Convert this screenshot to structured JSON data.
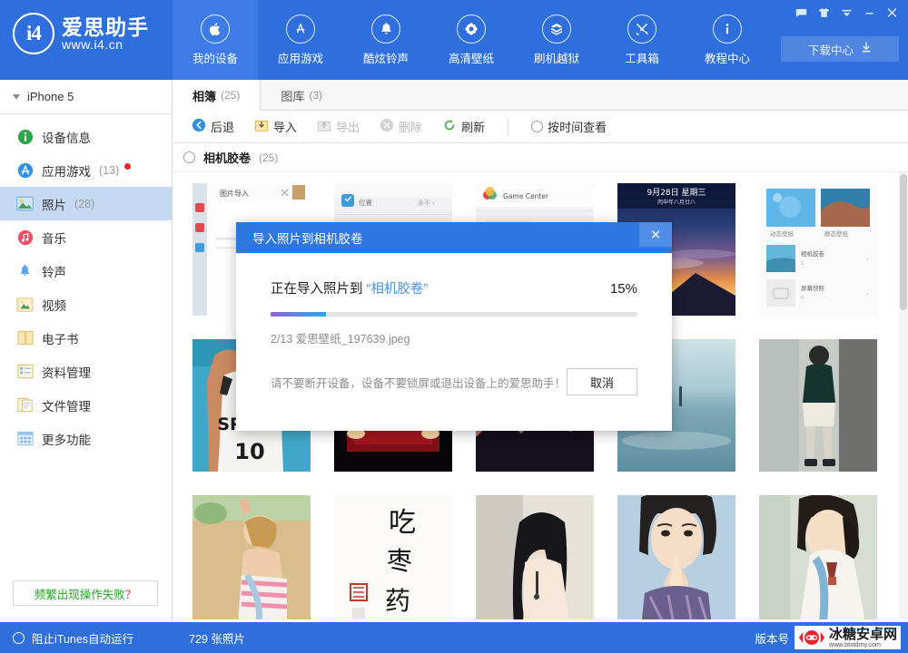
{
  "header": {
    "brand": {
      "logo_text": "i4",
      "name": "爱思助手",
      "url": "www.i4.cn"
    },
    "nav": [
      {
        "label": "我的设备",
        "icon": "apple-icon",
        "active": true
      },
      {
        "label": "应用游戏",
        "icon": "appstore-icon",
        "active": false
      },
      {
        "label": "酷炫铃声",
        "icon": "bell-icon",
        "active": false
      },
      {
        "label": "高清壁纸",
        "icon": "flower-icon",
        "active": false
      },
      {
        "label": "刷机越狱",
        "icon": "box-icon",
        "active": false
      },
      {
        "label": "工具箱",
        "icon": "tools-icon",
        "active": false
      },
      {
        "label": "教程中心",
        "icon": "info-icon",
        "active": false
      }
    ],
    "window_controls": [
      {
        "name": "message-icon",
        "glyph": "⌨"
      },
      {
        "name": "skin-icon",
        "glyph": "T"
      },
      {
        "name": "chevron-down-icon",
        "glyph": "▼"
      },
      {
        "name": "minimize-icon",
        "glyph": "–"
      },
      {
        "name": "close-icon",
        "glyph": "✕"
      }
    ],
    "download_center": {
      "label": "下载中心",
      "icon": "download-icon"
    }
  },
  "sidebar": {
    "device": "iPhone 5",
    "items": [
      {
        "label": "设备信息",
        "count": "",
        "icon": "info-circle-icon",
        "active": false,
        "badge": false
      },
      {
        "label": "应用游戏",
        "count": "(13)",
        "icon": "appstore-icon",
        "active": false,
        "badge": true
      },
      {
        "label": "照片",
        "count": "(28)",
        "icon": "photo-icon",
        "active": true,
        "badge": false
      },
      {
        "label": "音乐",
        "count": "",
        "icon": "music-icon",
        "active": false,
        "badge": false
      },
      {
        "label": "铃声",
        "count": "",
        "icon": "bell-icon",
        "active": false,
        "badge": false
      },
      {
        "label": "视频",
        "count": "",
        "icon": "video-icon",
        "active": false,
        "badge": false
      },
      {
        "label": "电子书",
        "count": "",
        "icon": "book-icon",
        "active": false,
        "badge": false
      },
      {
        "label": "资料管理",
        "count": "",
        "icon": "data-icon",
        "active": false,
        "badge": false
      },
      {
        "label": "文件管理",
        "count": "",
        "icon": "file-icon",
        "active": false,
        "badge": false
      },
      {
        "label": "更多功能",
        "count": "",
        "icon": "grid-icon",
        "active": false,
        "badge": false
      }
    ],
    "fail_button": {
      "text": "频繁出现操作失败",
      "question_mark": "？"
    }
  },
  "main": {
    "tabs": [
      {
        "label": "相簿",
        "count": "(25)",
        "active": true
      },
      {
        "label": "图库",
        "count": "(3)",
        "active": false
      }
    ],
    "toolbar": [
      {
        "label": "后退",
        "icon": "back-arrow-icon",
        "disabled": false
      },
      {
        "label": "导入",
        "icon": "import-icon",
        "disabled": false
      },
      {
        "label": "导出",
        "icon": "export-icon",
        "disabled": true
      },
      {
        "label": "删除",
        "icon": "delete-icon",
        "disabled": true
      },
      {
        "label": "刷新",
        "icon": "refresh-icon",
        "disabled": false
      }
    ],
    "view_toggle": {
      "label": "按时间查看",
      "icon": "radio-icon",
      "checked": false
    },
    "album": {
      "name": "相机胶卷",
      "count": "(25)",
      "icon": "radio-icon"
    },
    "thumbnails": [
      {
        "name": "screenshot-import-dialog",
        "kind": "screenshot"
      },
      {
        "name": "screenshot-settings-location",
        "kind": "screenshot"
      },
      {
        "name": "screenshot-game-center",
        "kind": "screenshot"
      },
      {
        "name": "wallpaper-sunset-lockscreen",
        "kind": "photo"
      },
      {
        "name": "screenshot-wallpaper-picker",
        "kind": "screenshot"
      },
      {
        "name": "photo-spurs-jersey",
        "kind": "photo"
      },
      {
        "name": "photo-red-car-rear",
        "kind": "photo"
      },
      {
        "name": "photo-dusk-mountain",
        "kind": "photo"
      },
      {
        "name": "photo-sea-horizon",
        "kind": "photo"
      },
      {
        "name": "photo-man-street-fashion",
        "kind": "photo"
      },
      {
        "name": "photo-beach-girl",
        "kind": "photo"
      },
      {
        "name": "photo-calligraphy",
        "kind": "photo"
      },
      {
        "name": "photo-long-hair-girl",
        "kind": "photo"
      },
      {
        "name": "photo-praying-girl",
        "kind": "photo"
      },
      {
        "name": "photo-braid-girl",
        "kind": "photo"
      }
    ]
  },
  "dialog": {
    "title": "导入照片到相机胶卷",
    "close_glyph": "✕",
    "status_prefix": "正在导入照片到",
    "target": "“相机胶卷”",
    "percent": "15%",
    "progress_value": 15,
    "file": "2/13 爱思壁纸_197639.jpeg",
    "note": "请不要断开设备，设备不要锁屏或退出设备上的爱思助手！",
    "cancel_label": "取消"
  },
  "status_bar": {
    "itunes_toggle": "阻止iTunes自动运行",
    "photo_count": "729 张照片",
    "version_label": "版本号",
    "watermark": {
      "name": "冰糖安卓网",
      "url": "www.btxtdmy.com"
    }
  },
  "colors": {
    "brand_blue": "#2f6fdd",
    "nav_active": "#3d7ce6",
    "sidebar_active": "#c5d9f3",
    "dialog_header": "#2f77e0",
    "accent_link": "#4b8fe3",
    "badge_red": "#e8261d",
    "success_green": "#1ca81c",
    "watermark_red": "#e8242d"
  }
}
